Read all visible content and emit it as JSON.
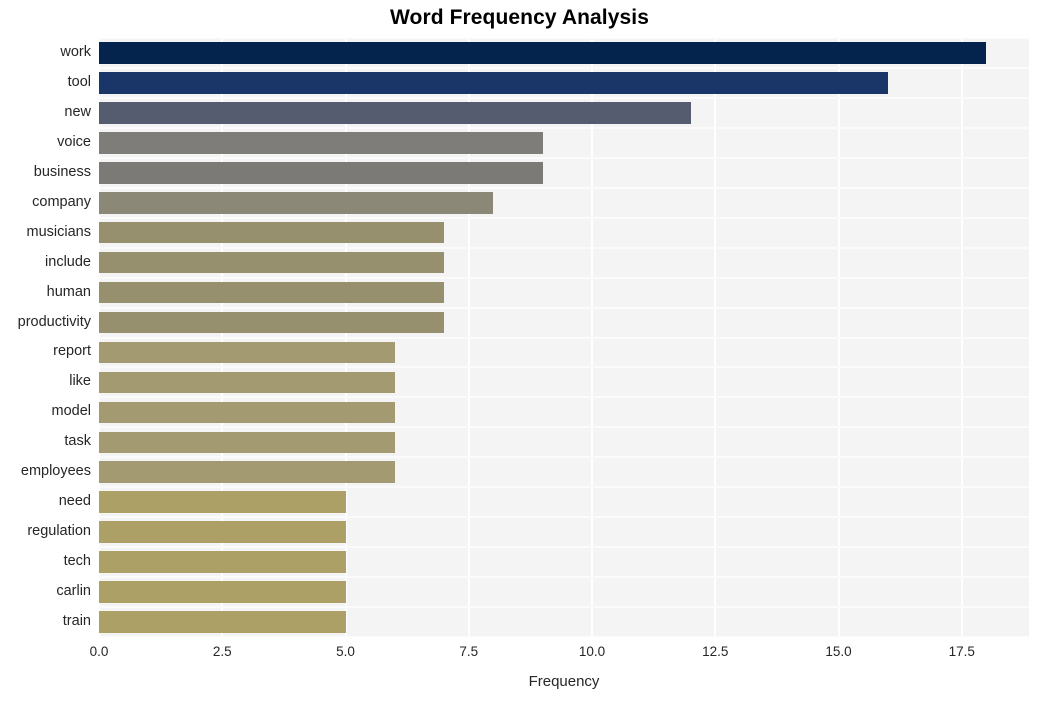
{
  "chart_data": {
    "type": "bar",
    "orientation": "horizontal",
    "title": "Word Frequency Analysis",
    "xlabel": "Frequency",
    "ylabel": "",
    "xlim": [
      0,
      18.6
    ],
    "ylim": null,
    "grid": true,
    "legend": null,
    "xticks": [
      "0.0",
      "2.5",
      "5.0",
      "7.5",
      "10.0",
      "12.5",
      "15.0",
      "17.5"
    ],
    "xtick_values": [
      0.0,
      2.5,
      5.0,
      7.5,
      10.0,
      12.5,
      15.0,
      17.5
    ],
    "categories": [
      "work",
      "tool",
      "new",
      "voice",
      "business",
      "company",
      "musicians",
      "include",
      "human",
      "productivity",
      "report",
      "like",
      "model",
      "task",
      "employees",
      "need",
      "regulation",
      "tech",
      "carlin",
      "train"
    ],
    "values": [
      18,
      16,
      12,
      9,
      9,
      8,
      7,
      7,
      7,
      7,
      6,
      6,
      6,
      6,
      6,
      5,
      5,
      5,
      5,
      5
    ],
    "bar_colors": [
      "#04234d",
      "#1a3668",
      "#565c70",
      "#7e7d7a",
      "#7b7a77",
      "#8c8878",
      "#96906f",
      "#96906f",
      "#96906f",
      "#96906f",
      "#a39a72",
      "#a39a72",
      "#a39a72",
      "#a39a72",
      "#a39a72",
      "#aca067",
      "#aca067",
      "#aca067",
      "#aca067",
      "#aca067"
    ]
  },
  "style": {
    "plot_background": "#f4f4f5",
    "figure_background": "#ffffff",
    "gridline_color": "#ffffff",
    "text_color": "#262626",
    "title_color": "#000000"
  }
}
